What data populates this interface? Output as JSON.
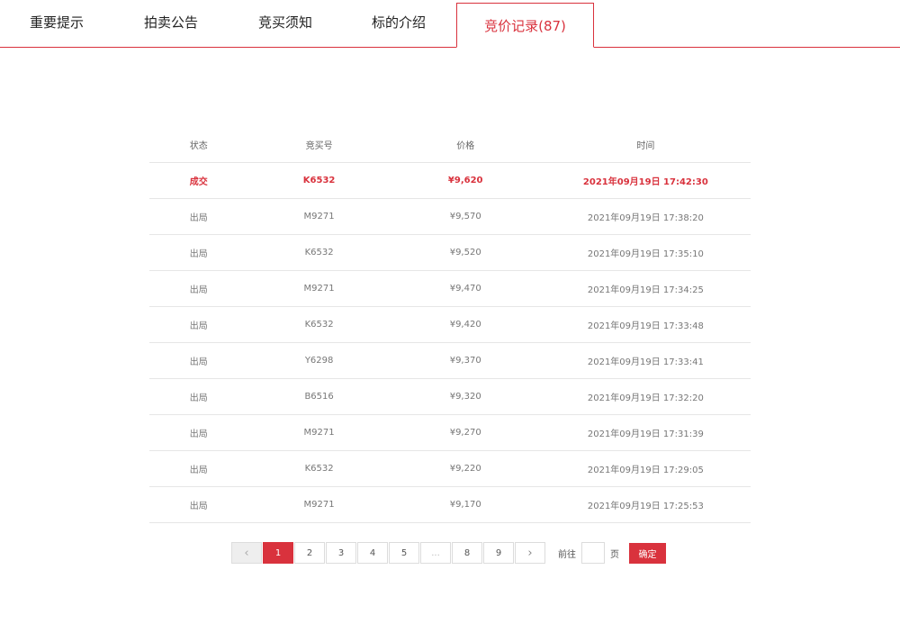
{
  "tabs": [
    {
      "label": "重要提示",
      "active": false
    },
    {
      "label": "拍卖公告",
      "active": false
    },
    {
      "label": "竞买须知",
      "active": false
    },
    {
      "label": "标的介绍",
      "active": false
    },
    {
      "label": "竞价记录(87)",
      "active": true
    }
  ],
  "table": {
    "headers": [
      "状态",
      "竞买号",
      "价格",
      "时间"
    ],
    "rows": [
      {
        "status": "成交",
        "bidder": "K6532",
        "price": "¥9,620",
        "time": "2021年09月19日  17:42:30"
      },
      {
        "status": "出局",
        "bidder": "M9271",
        "price": "¥9,570",
        "time": "2021年09月19日  17:38:20"
      },
      {
        "status": "出局",
        "bidder": "K6532",
        "price": "¥9,520",
        "time": "2021年09月19日  17:35:10"
      },
      {
        "status": "出局",
        "bidder": "M9271",
        "price": "¥9,470",
        "time": "2021年09月19日  17:34:25"
      },
      {
        "status": "出局",
        "bidder": "K6532",
        "price": "¥9,420",
        "time": "2021年09月19日  17:33:48"
      },
      {
        "status": "出局",
        "bidder": "Y6298",
        "price": "¥9,370",
        "time": "2021年09月19日  17:33:41"
      },
      {
        "status": "出局",
        "bidder": "B6516",
        "price": "¥9,320",
        "time": "2021年09月19日  17:32:20"
      },
      {
        "status": "出局",
        "bidder": "M9271",
        "price": "¥9,270",
        "time": "2021年09月19日  17:31:39"
      },
      {
        "status": "出局",
        "bidder": "K6532",
        "price": "¥9,220",
        "time": "2021年09月19日  17:29:05"
      },
      {
        "status": "出局",
        "bidder": "M9271",
        "price": "¥9,170",
        "time": "2021年09月19日  17:25:53"
      }
    ]
  },
  "pagination": {
    "prev_icon": "‹",
    "pages": [
      "1",
      "2",
      "3",
      "4",
      "5",
      "...",
      "8",
      "9"
    ],
    "current": "1",
    "next_icon": "›",
    "goto_label": "前往",
    "goto_value": "",
    "page_unit": "页",
    "confirm_label": "确定"
  },
  "colors": {
    "accent": "#d9323d",
    "border": "#e6e6e6"
  }
}
